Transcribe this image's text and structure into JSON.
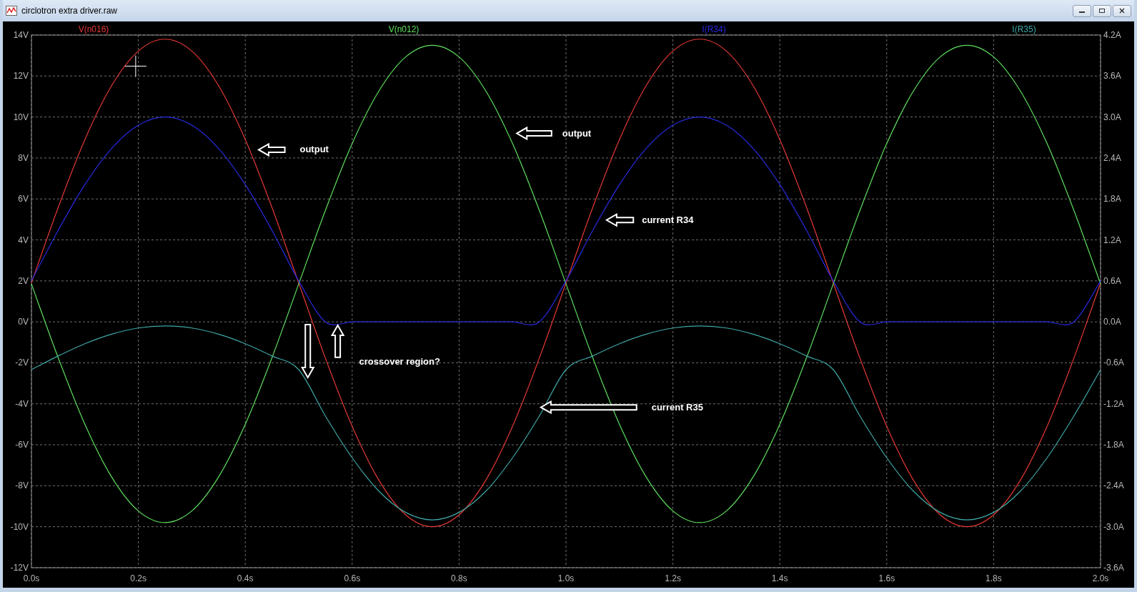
{
  "window": {
    "title": "circlotron extra driver.raw"
  },
  "plot": {
    "chart_data": {
      "type": "line",
      "x": [
        0,
        0.05,
        0.1,
        0.15,
        0.2,
        0.25,
        0.3,
        0.35,
        0.4,
        0.45,
        0.5,
        0.55,
        0.6,
        0.65,
        0.7,
        0.75,
        0.8,
        0.85,
        0.9,
        0.95,
        1,
        1.05,
        1.1,
        1.15,
        1.2,
        1.25,
        1.3,
        1.35,
        1.4,
        1.45,
        1.5,
        1.55,
        1.6,
        1.65,
        1.7,
        1.75,
        1.8,
        1.85,
        1.9,
        1.95,
        2
      ],
      "grid": true,
      "xlim": [
        0,
        2
      ],
      "ylim": [
        -12,
        14
      ],
      "y2lim": [
        -3.6,
        4.2
      ],
      "xticks": [
        {
          "value": 0,
          "label": "0.0s"
        },
        {
          "value": 0.2,
          "label": "0.2s"
        },
        {
          "value": 0.4,
          "label": "0.4s"
        },
        {
          "value": 0.6,
          "label": "0.6s"
        },
        {
          "value": 0.8,
          "label": "0.8s"
        },
        {
          "value": 1,
          "label": "1.0s"
        },
        {
          "value": 1.2,
          "label": "1.2s"
        },
        {
          "value": 1.4,
          "label": "1.4s"
        },
        {
          "value": 1.6,
          "label": "1.6s"
        },
        {
          "value": 1.8,
          "label": "1.8s"
        },
        {
          "value": 2,
          "label": "2.0s"
        }
      ],
      "yticks": [
        {
          "value": 14,
          "label": "14V"
        },
        {
          "value": 12,
          "label": "12V"
        },
        {
          "value": 10,
          "label": "10V"
        },
        {
          "value": 8,
          "label": "8V"
        },
        {
          "value": 6,
          "label": "6V"
        },
        {
          "value": 4,
          "label": "4V"
        },
        {
          "value": 2,
          "label": "2V"
        },
        {
          "value": 0,
          "label": "0V"
        },
        {
          "value": -2,
          "label": "-2V"
        },
        {
          "value": -4,
          "label": "-4V"
        },
        {
          "value": -6,
          "label": "-6V"
        },
        {
          "value": -8,
          "label": "-8V"
        },
        {
          "value": -10,
          "label": "-10V"
        },
        {
          "value": -12,
          "label": "-12V"
        }
      ],
      "y2ticks": [
        {
          "value": 4.2,
          "label": "4.2A"
        },
        {
          "value": 3.6,
          "label": "3.6A"
        },
        {
          "value": 3.0,
          "label": "3.0A"
        },
        {
          "value": 2.4,
          "label": "2.4A"
        },
        {
          "value": 1.8,
          "label": "1.8A"
        },
        {
          "value": 1.2,
          "label": "1.2A"
        },
        {
          "value": 0.6,
          "label": "0.6A"
        },
        {
          "value": 0,
          "label": "0.0A"
        },
        {
          "value": -0.6,
          "label": "-0.6A"
        },
        {
          "value": -1.2,
          "label": "-1.2A"
        },
        {
          "value": -1.8,
          "label": "-1.8A"
        },
        {
          "value": -2.4,
          "label": "-2.4A"
        },
        {
          "value": -3.0,
          "label": "-3.0A"
        },
        {
          "value": -3.6,
          "label": "-3.6A"
        }
      ],
      "series": [
        {
          "name": "V(n016)",
          "color": "#e53935",
          "values": [
            1.9,
            5.58,
            8.9,
            11.53,
            13.22,
            13.8,
            13.22,
            11.53,
            8.9,
            5.58,
            1.9,
            -1.78,
            -5.1,
            -7.73,
            -9.42,
            -10,
            -9.42,
            -7.73,
            -5.1,
            -1.78,
            1.9,
            5.58,
            8.9,
            11.53,
            13.22,
            13.8,
            13.22,
            11.53,
            8.9,
            5.58,
            1.9,
            -1.78,
            -5.1,
            -7.73,
            -9.42,
            -10,
            -9.42,
            -7.73,
            -5.1,
            -1.78,
            1.9
          ]
        },
        {
          "name": "V(n012)",
          "color": "#5ee05e",
          "values": [
            1.85,
            -1.75,
            -5.0,
            -7.57,
            -9.23,
            -9.8,
            -9.23,
            -7.57,
            -5.0,
            -1.75,
            1.85,
            5.45,
            8.7,
            11.27,
            12.93,
            13.5,
            12.93,
            11.27,
            8.7,
            5.45,
            1.85,
            -1.75,
            -5.0,
            -7.57,
            -9.23,
            -9.8,
            -9.23,
            -7.57,
            -5.0,
            -1.75,
            1.85,
            5.45,
            8.7,
            11.27,
            12.93,
            13.5,
            12.93,
            11.27,
            8.7,
            5.45,
            1.85
          ]
        },
        {
          "name": "I(R34)",
          "color": "#2a2ae0",
          "axis": "y2",
          "values": [
            0.6,
            1.34,
            2.01,
            2.54,
            2.88,
            3.0,
            2.88,
            2.54,
            2.01,
            1.34,
            0.6,
            0,
            0,
            0,
            0,
            0,
            0,
            0,
            0,
            0,
            0.6,
            1.34,
            2.01,
            2.54,
            2.88,
            3.0,
            2.88,
            2.54,
            2.01,
            1.34,
            0.6,
            0,
            0,
            0,
            0,
            0,
            0,
            0,
            0,
            0,
            0.6
          ]
        },
        {
          "name": "I(R35)",
          "color": "#3fa6a6",
          "axis": "y2",
          "values": [
            -0.7,
            -0.5,
            -0.32,
            -0.18,
            -0.09,
            -0.06,
            -0.09,
            -0.18,
            -0.32,
            -0.5,
            -0.7,
            -1.38,
            -1.99,
            -2.48,
            -2.79,
            -2.9,
            -2.79,
            -2.48,
            -1.99,
            -1.38,
            -0.7,
            -0.5,
            -0.32,
            -0.18,
            -0.09,
            -0.06,
            -0.09,
            -0.18,
            -0.32,
            -0.5,
            -0.7,
            -1.38,
            -1.99,
            -2.48,
            -2.79,
            -2.9,
            -2.79,
            -2.48,
            -1.99,
            -1.38,
            -0.7
          ]
        }
      ],
      "annotations": [
        "output",
        "output",
        "current R34",
        "crossover region?",
        "current R35"
      ]
    }
  }
}
